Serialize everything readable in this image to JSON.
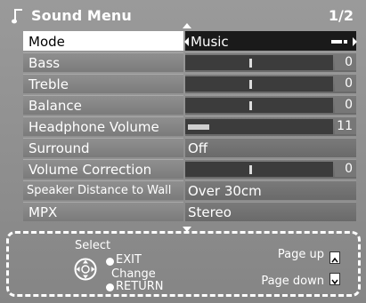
{
  "header": {
    "title": "Sound Menu",
    "page": "1/2",
    "icon": "music-note-icon"
  },
  "menu": [
    {
      "label": "Mode",
      "value": "Music",
      "selected": true
    },
    {
      "label": "Bass",
      "value": "0",
      "type": "slider",
      "level": 0
    },
    {
      "label": "Treble",
      "value": "0",
      "type": "slider",
      "level": 0
    },
    {
      "label": "Balance",
      "value": "0",
      "type": "slider",
      "level": 0
    },
    {
      "label": "Headphone Volume",
      "value": "11",
      "type": "volume"
    },
    {
      "label": "Surround",
      "value": "Off"
    },
    {
      "label": "Volume Correction",
      "value": "0",
      "type": "slider",
      "level": 0
    },
    {
      "label": "Speaker Distance to Wall",
      "value": "Over 30cm"
    },
    {
      "label": "MPX",
      "value": "Stereo"
    }
  ],
  "footer": {
    "select": "Select",
    "exit": "EXIT",
    "change": "Change",
    "return": "RETURN",
    "page_up": "Page up",
    "page_down": "Page down",
    "page_up_key": "˄",
    "page_down_key": "˅"
  },
  "colors": {
    "background": "#8d8d8d",
    "selected_label_bg": "#ffffff",
    "selected_value_bg": "#1a1a1a",
    "bar_bg": "#3c3c3c",
    "text": "#ffffff"
  }
}
